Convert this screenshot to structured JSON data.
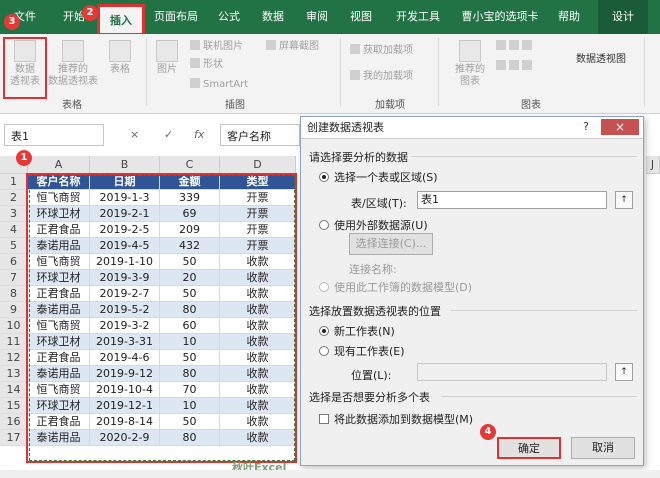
{
  "ribbon_tabs": [
    "文件",
    "开始",
    "插入",
    "页面布局",
    "公式",
    "数据",
    "审阅",
    "视图",
    "开发工具",
    "曹小宝的选项卡",
    "帮助",
    "设计"
  ],
  "ribbon": {
    "pivot_table": "数据透视表",
    "pivot_table_lines": [
      "数据",
      "透视表"
    ],
    "recommended_pivot_lines": [
      "推荐的",
      "数据透视表"
    ],
    "table": "表格",
    "group_tables": "表格",
    "picture": "图片",
    "online_picture": "联机图片",
    "shapes": "形状",
    "smartart": "SmartArt",
    "screenshot": "屏幕截图",
    "group_illustrations": "插图",
    "get_addins": "获取加载项",
    "my_addins": "我的加载项",
    "group_addins": "加载项",
    "recommended_charts_lines": [
      "推荐的",
      "图表"
    ],
    "pivot_chart": "数据透视图",
    "group_charts": "图表"
  },
  "formula_bar": {
    "name_box": "表1",
    "cancel": "×",
    "confirm": "✓",
    "fx": "fx",
    "value": "客户名称"
  },
  "sheet": {
    "columns": [
      "A",
      "B",
      "C",
      "D"
    ],
    "extra_column": "J",
    "rows": [
      [
        "客户名称",
        "日期",
        "金额",
        "类型"
      ],
      [
        "恒飞商贸",
        "2019-1-3",
        "339",
        "开票"
      ],
      [
        "环球卫材",
        "2019-2-1",
        "69",
        "开票"
      ],
      [
        "正君食品",
        "2019-2-5",
        "209",
        "开票"
      ],
      [
        "泰诺用品",
        "2019-4-5",
        "432",
        "开票"
      ],
      [
        "恒飞商贸",
        "2019-1-10",
        "50",
        "收款"
      ],
      [
        "环球卫材",
        "2019-3-9",
        "20",
        "收款"
      ],
      [
        "正君食品",
        "2019-2-7",
        "50",
        "收款"
      ],
      [
        "泰诺用品",
        "2019-5-2",
        "80",
        "收款"
      ],
      [
        "恒飞商贸",
        "2019-3-2",
        "60",
        "收款"
      ],
      [
        "环球卫材",
        "2019-3-31",
        "10",
        "收款"
      ],
      [
        "正君食品",
        "2019-4-6",
        "50",
        "收款"
      ],
      [
        "泰诺用品",
        "2019-9-12",
        "80",
        "收款"
      ],
      [
        "恒飞商贸",
        "2019-10-4",
        "70",
        "收款"
      ],
      [
        "环球卫材",
        "2019-12-1",
        "10",
        "收款"
      ],
      [
        "正君食品",
        "2019-8-14",
        "50",
        "收款"
      ],
      [
        "泰诺用品",
        "2020-2-9",
        "80",
        "收款"
      ]
    ],
    "watermark": "秋叶Excel"
  },
  "markers": [
    "1",
    "2",
    "3",
    "4"
  ],
  "dialog": {
    "title": "创建数据透视表",
    "help": "?",
    "close": "×",
    "section1": "请选择要分析的数据",
    "opt_select_range": "选择一个表或区域(S)",
    "range_label": "表/区域(T):",
    "range_value": "表1",
    "opt_external": "使用外部数据源(U)",
    "choose_conn": "选择连接(C)...",
    "conn_name": "连接名称:",
    "opt_datamodel": "使用此工作簿的数据模型(D)",
    "section2": "选择放置数据透视表的位置",
    "opt_new_sheet": "新工作表(N)",
    "opt_existing": "现有工作表(E)",
    "location_label": "位置(L):",
    "section3": "选择是否想要分析多个表",
    "add_to_model": "将此数据添加到数据模型(M)",
    "ok": "确定",
    "cancel": "取消",
    "picker": "↑"
  }
}
